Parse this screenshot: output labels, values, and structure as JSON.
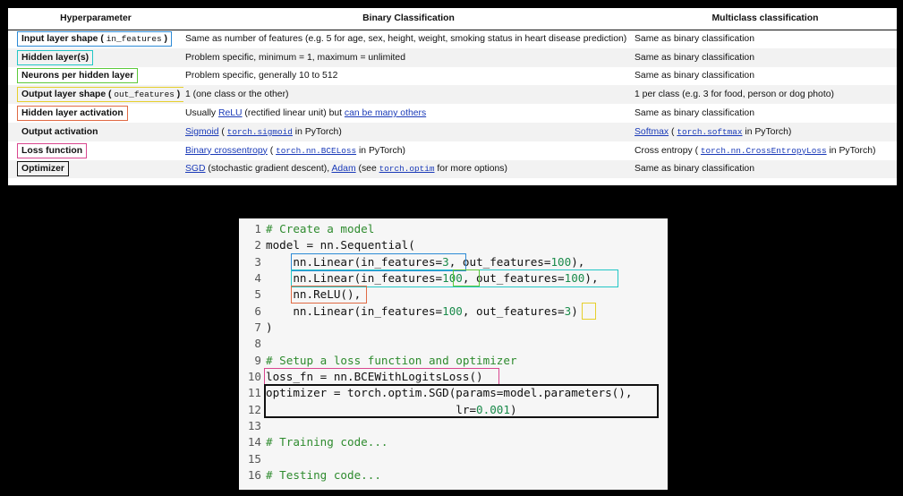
{
  "table": {
    "headers": [
      "Hyperparameter",
      "Binary Classification",
      "Multiclass classification"
    ],
    "rows": [
      {
        "label": "Input layer shape",
        "label_code": "in_features",
        "binary": "Same as number of features (e.g. 5 for age, sex, height, weight, smoking status in heart disease prediction)",
        "multi": "Same as binary classification"
      },
      {
        "label": "Hidden layer(s)",
        "binary": "Problem specific, minimum = 1, maximum = unlimited",
        "multi": "Same as binary classification"
      },
      {
        "label": "Neurons per hidden layer",
        "binary": "Problem specific, generally 10 to 512",
        "multi": "Same as binary classification"
      },
      {
        "label": "Output layer shape",
        "label_code": "out_features",
        "binary": "1 (one class or the other)",
        "multi": "1 per class (e.g. 3 for food, person or dog photo)"
      },
      {
        "label": "Hidden layer activation",
        "binary_pre": "Usually ",
        "binary_link1": "ReLU",
        "binary_mid": " (rectified linear unit) but ",
        "binary_link2": "can be many others",
        "multi": "Same as binary classification"
      },
      {
        "label": "Output activation",
        "binary_link": "Sigmoid",
        "binary_code": "torch.sigmoid",
        "binary_post": " in PyTorch)",
        "multi_link": "Softmax",
        "multi_code": "torch.softmax",
        "multi_post": " in PyTorch)"
      },
      {
        "label": "Loss function",
        "binary_link": "Binary crossentropy",
        "binary_code": "torch.nn.BCELoss",
        "binary_post": " in PyTorch)",
        "multi_pre": "Cross entropy ( ",
        "multi_code": "torch.nn.CrossEntropyLoss",
        "multi_post": " in PyTorch)"
      },
      {
        "label": "Optimizer",
        "binary_link1": "SGD",
        "binary_mid": " (stochastic gradient descent), ",
        "binary_link2": "Adam",
        "binary_mid2": " (see ",
        "binary_code": "torch.optim",
        "binary_post": " for more options)",
        "multi": "Same as binary classification"
      }
    ],
    "paren_open": " ( ",
    "paren_close": " )"
  },
  "code": {
    "line_numbers": [
      "1",
      "2",
      "3",
      "4",
      "5",
      "6",
      "7",
      "8",
      "9",
      "10",
      "11",
      "12",
      "13",
      "14",
      "15",
      "16"
    ],
    "l1": "# Create a model",
    "l2": "model = nn.Sequential(",
    "l3a": "    nn.Linear(in_features=",
    "l3n": "3",
    "l3b": ", out_features=",
    "l3m": "100",
    "l3c": "),",
    "l4a": "    nn.Linear(in_features=",
    "l4n": "100",
    "l4b": ", out_features=",
    "l4m": "100",
    "l4c": "),",
    "l5": "    nn.ReLU(),",
    "l6a": "    nn.Linear(in_features=",
    "l6n": "100",
    "l6b": ", out_features=",
    "l6m": "3",
    "l6c": ")",
    "l7": ")",
    "l9": "# Setup a loss function and optimizer",
    "l10": "loss_fn = nn.BCEWithLogitsLoss()",
    "l11": "optimizer = torch.optim.SGD(params=model.parameters(),",
    "l12a": "                            lr=",
    "l12n": "0.001",
    "l12c": ")",
    "l14": "# Training code...",
    "l16": "# Testing code..."
  },
  "colors": {
    "input_layer": "#2d8bd6",
    "hidden_layers": "#22c6c6",
    "neurons": "#5cc93a",
    "output_layer": "#e6cf2c",
    "hidden_activation": "#e06a44",
    "loss": "#d9468f",
    "optimizer": "#111111",
    "comment": "#2e8b2e",
    "number": "#1a8a4a"
  }
}
